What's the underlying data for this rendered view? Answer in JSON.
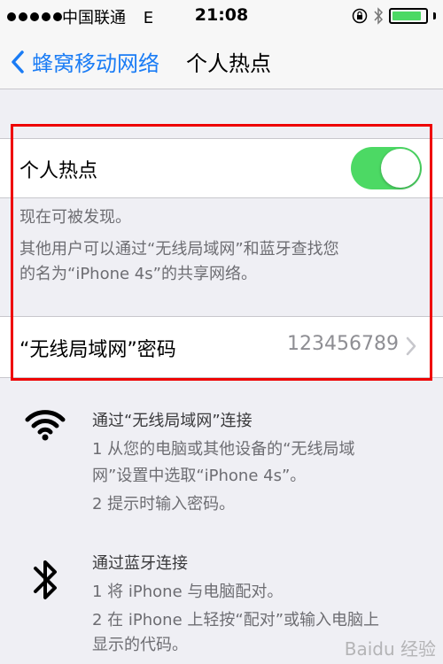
{
  "status_bar": {
    "carrier": "中国联通",
    "network": "E",
    "time": "21:08",
    "battery_level": 0.9
  },
  "nav": {
    "back_label": "蜂窝移动网络",
    "title": "个人热点"
  },
  "hotspot": {
    "label": "个人热点",
    "enabled": true
  },
  "info": {
    "discoverable": "现在可被发现。",
    "line1": "其他用户可以通过“无线局域网”和蓝牙查找您",
    "line2": "的名为“iPhone 4s”的共享网络。"
  },
  "password_row": {
    "label": "“无线局域网”密码",
    "value": "123456789"
  },
  "wifi_section": {
    "title": "通过“无线局域网”连接",
    "step1_line1": "1 从您的电脑或其他设备的“无线局域",
    "step1_line2": "网”设置中选取“iPhone 4s”。",
    "step2": "2 提示时输入密码。"
  },
  "bt_section": {
    "title": "通过蓝牙连接",
    "step1": "1 将 iPhone 与电脑配对。",
    "step2_line1": "2 在 iPhone 上轻按“配对”或输入电脑上",
    "step2_line2": "显示的代码。"
  },
  "watermark": "Baidu 经验",
  "colors": {
    "accent": "#1a7cf5",
    "toggle_on": "#4cd964",
    "highlight_box": "#ee0000"
  }
}
